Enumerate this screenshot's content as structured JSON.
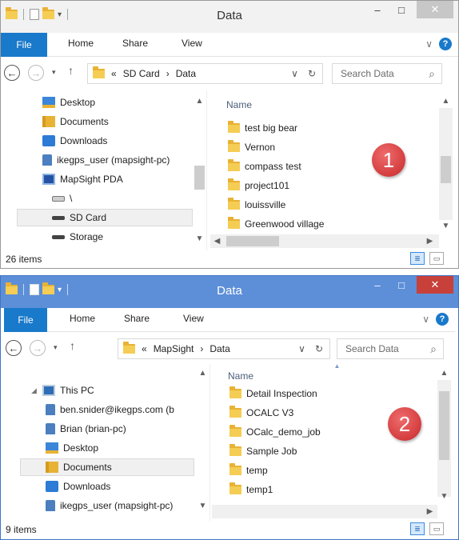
{
  "window1": {
    "title": "Data",
    "ribbon_tabs": {
      "file": "File",
      "home": "Home",
      "share": "Share",
      "view": "View"
    },
    "breadcrumb": {
      "overflow": "«",
      "parts": [
        "SD Card",
        "Data"
      ],
      "sep": "›"
    },
    "search_placeholder": "Search Data",
    "nav_items": [
      "Desktop",
      "Documents",
      "Downloads",
      "ikegps_user (mapsight-pc)",
      "MapSight PDA",
      "\\",
      "SD Card",
      "Storage"
    ],
    "selected_nav": "SD Card",
    "column_header": "Name",
    "files": [
      "test big bear",
      "Vernon",
      "compass test",
      "project101",
      "louissville",
      "Greenwood village"
    ],
    "status": "26 items",
    "badge": "1"
  },
  "window2": {
    "title": "Data",
    "ribbon_tabs": {
      "file": "File",
      "home": "Home",
      "share": "Share",
      "view": "View"
    },
    "breadcrumb": {
      "overflow": "«",
      "parts": [
        "MapSight",
        "Data"
      ],
      "sep": "›"
    },
    "search_placeholder": "Search Data",
    "nav_items": [
      "This PC",
      "ben.snider@ikegps.com (b",
      "Brian (brian-pc)",
      "Desktop",
      "Documents",
      "Downloads",
      "ikegps_user (mapsight-pc)"
    ],
    "selected_nav": "Documents",
    "column_header": "Name",
    "files": [
      "Detail Inspection",
      "OCALC V3",
      "OCalc_demo_job",
      "Sample Job",
      "temp",
      "temp1"
    ],
    "status": "9 items",
    "badge": "2"
  },
  "icons": {
    "window_minimize": "–",
    "window_maximize": "□",
    "window_close": "✕",
    "back": "←",
    "forward": "→",
    "up": "↑",
    "recent": "▾",
    "refresh": "↻",
    "search": "⌕",
    "dropdown": "∨",
    "help": "?",
    "scroll_up": "▲",
    "scroll_down": "▼",
    "scroll_left": "◀",
    "scroll_right": "▶",
    "sort": "▲"
  },
  "colors": {
    "file_tab": "#1979ca",
    "active_titlebar": "#5d8fd8",
    "close_active": "#c7403a",
    "badge": "#d23a3a"
  }
}
